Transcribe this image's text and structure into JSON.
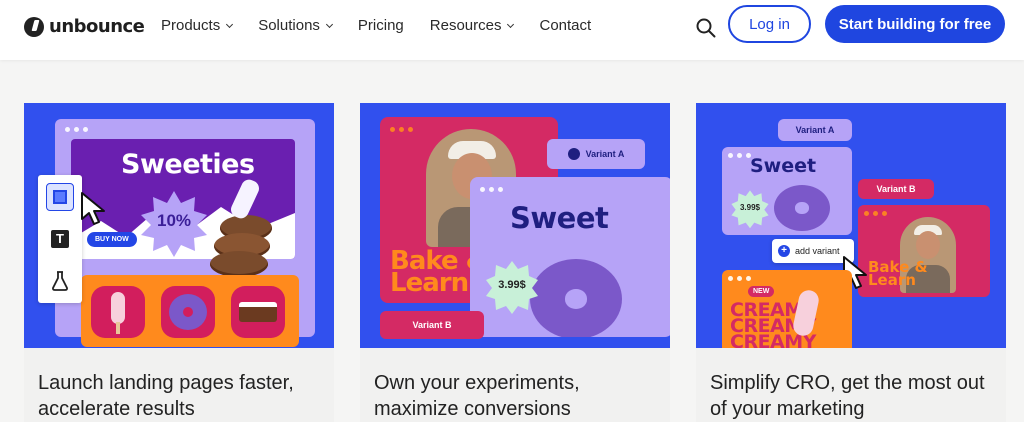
{
  "nav": {
    "logo_text": "unbounce",
    "menu": [
      {
        "label": "Products",
        "has_dropdown": true
      },
      {
        "label": "Solutions",
        "has_dropdown": true
      },
      {
        "label": "Pricing",
        "has_dropdown": false
      },
      {
        "label": "Resources",
        "has_dropdown": true
      },
      {
        "label": "Contact",
        "has_dropdown": false
      }
    ],
    "search_icon": "search-icon",
    "login_label": "Log in",
    "cta_label": "Start building for free"
  },
  "colors": {
    "brand_blue": "#1f46e0",
    "card_bg": "#3150ee",
    "lavender": "#b6a3f7",
    "magenta": "#d42a64",
    "orange": "#ff8a1d",
    "purple": "#6a1fb0"
  },
  "cards": [
    {
      "caption": "Launch landing pages faster, accelerate results",
      "art": {
        "title": "Sweeties",
        "badge": "10%",
        "button": "BUY NOW",
        "tools": [
          "layout-icon",
          "text-icon",
          "flask-icon"
        ]
      }
    },
    {
      "caption": "Own your experiments, maximize conversions",
      "art": {
        "variant_a": "Variant A",
        "variant_b": "Variant B",
        "bake": "Bake & Learn",
        "title": "Sweet",
        "price": "3.99$"
      }
    },
    {
      "caption": "Simplify CRO, get the most out of your marketing",
      "art": {
        "variant_a": "Variant A",
        "variant_b": "Variant B",
        "title": "Sweet",
        "price": "3.99$",
        "add_variant": "add variant",
        "bake": "Bake & Learn",
        "new_badge": "NEW",
        "creamy": "CREAMY"
      }
    }
  ]
}
